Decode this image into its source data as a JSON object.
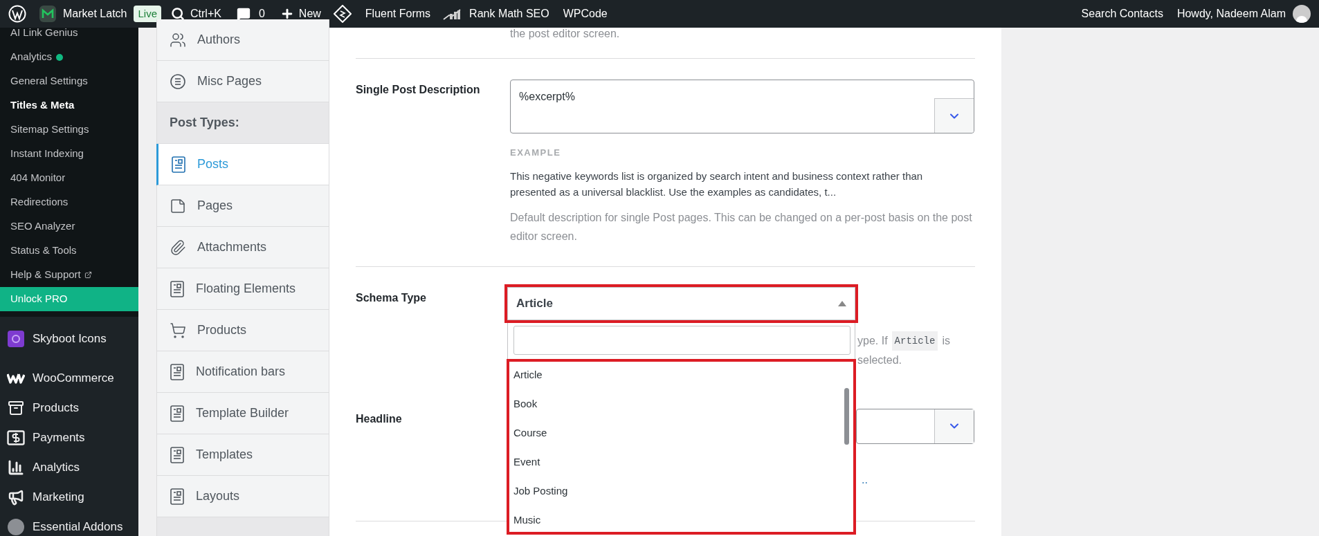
{
  "admin_bar": {
    "site_name": "Market Latch",
    "live_badge": "Live",
    "search_shortcut": "Ctrl+K",
    "comments_count": "0",
    "new_label": "New",
    "plugins": [
      "Fluent Forms",
      "Rank Math SEO",
      "WPCode"
    ],
    "search_contacts": "Search Contacts",
    "greeting": "Howdy, Nadeem Alam"
  },
  "sidebar": {
    "submenu": [
      {
        "label": "AI Link Genius",
        "current": false
      },
      {
        "label": "Analytics",
        "current": false,
        "color": "#10b981"
      },
      {
        "label": "General Settings",
        "current": false
      },
      {
        "label": "Titles & Meta",
        "current": true
      },
      {
        "label": "Sitemap Settings",
        "current": false
      },
      {
        "label": "Instant Indexing",
        "current": false
      },
      {
        "label": "404 Monitor",
        "current": false
      },
      {
        "label": "Redirections",
        "current": false
      },
      {
        "label": "SEO Analyzer",
        "current": false
      },
      {
        "label": "Status & Tools",
        "current": false
      },
      {
        "label": "Help & Support",
        "current": false,
        "external": true
      }
    ],
    "unlock": "Unlock PRO",
    "menu": [
      {
        "label": "Skyboot Icons",
        "kind": "skyboot"
      },
      {
        "label": "WooCommerce",
        "kind": "woo"
      },
      {
        "label": "Products",
        "kind": "products"
      },
      {
        "label": "Payments",
        "kind": "payments"
      },
      {
        "label": "Analytics",
        "kind": "analytics"
      },
      {
        "label": "Marketing",
        "kind": "marketing"
      },
      {
        "label": "Essential Addons",
        "kind": "addons"
      }
    ]
  },
  "tabs": [
    {
      "label": "Authors",
      "kind": "authors",
      "selected": false
    },
    {
      "label": "Misc Pages",
      "kind": "misc",
      "selected": false
    },
    {
      "label": "Post Types:",
      "kind": "heading",
      "selected": false
    },
    {
      "label": "Posts",
      "kind": "doc",
      "selected": true
    },
    {
      "label": "Pages",
      "kind": "page",
      "selected": false
    },
    {
      "label": "Attachments",
      "kind": "clip",
      "selected": false
    },
    {
      "label": "Floating Elements",
      "kind": "doc",
      "selected": false
    },
    {
      "label": "Products",
      "kind": "cart",
      "selected": false
    },
    {
      "label": "Notification bars",
      "kind": "doc",
      "selected": false
    },
    {
      "label": "Template Builder",
      "kind": "doc",
      "selected": false
    },
    {
      "label": "Templates",
      "kind": "doc",
      "selected": false
    },
    {
      "label": "Layouts",
      "kind": "doc",
      "selected": false
    }
  ],
  "content": {
    "top_text": "the post editor screen.",
    "description_field": {
      "label": "Single Post Description",
      "value": "%excerpt%",
      "example_heading": "EXAMPLE",
      "example_text": "This negative keywords list is organized by search intent and business context rather than presented as a universal blacklist. Use the examples as candidates, t...",
      "help": "Default description for single Post pages. This can be changed on a per-post basis on the post editor screen."
    },
    "schema_field": {
      "label": "Schema Type",
      "value": "Article",
      "hint_line_1": "ype. If",
      "hint_code": "Article",
      "hint_is": "is",
      "hint_line_2": "selected.",
      "expanded": true,
      "options": [
        "Article",
        "Book",
        "Course",
        "Event",
        "Job Posting",
        "Music"
      ]
    },
    "headline_field": {
      "label": "Headline",
      "trailing_text": ".."
    }
  }
}
